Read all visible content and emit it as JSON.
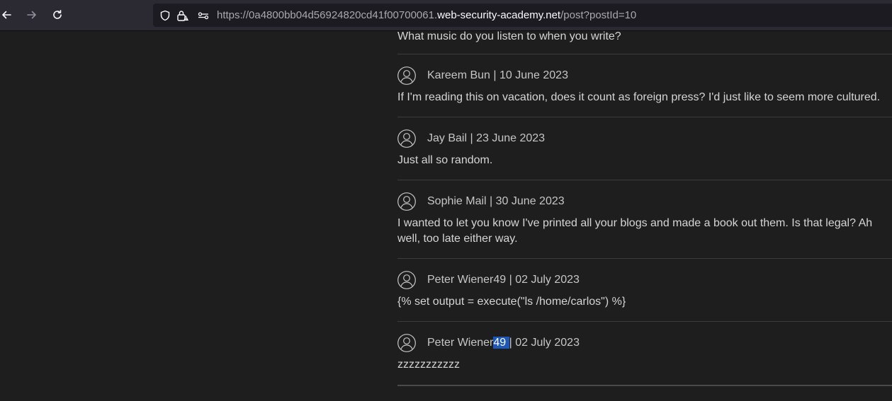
{
  "browser": {
    "back_icon": "arrow-left-icon",
    "forward_icon": "arrow-right-icon",
    "reload_icon": "reload-icon",
    "url_prefix": "https://0a4800bb04d56924820cd41f00700061.",
    "url_host": "web-security-academy.net",
    "url_path": "/post?postId=10"
  },
  "comments_partial": {
    "text": "What music do you listen to when you write?"
  },
  "comments": [
    {
      "author": "Kareem Bun",
      "sep": " | ",
      "date": "10 June 2023",
      "text": "If I'm reading this on vacation, does it count as foreign press? I'd just like to seem more cultured."
    },
    {
      "author": "Jay Bail",
      "sep": " | ",
      "date": "23 June 2023",
      "text": "Just all so random."
    },
    {
      "author": "Sophie Mail",
      "sep": " | ",
      "date": "30 June 2023",
      "text": "I wanted to let you know I've printed all your blogs and made a book out them. Is that legal? Ah well, too late either way."
    },
    {
      "author": "Peter Wiener49",
      "sep": " | ",
      "date": "02 July 2023",
      "text": "{% set output = execute(\"ls /home/carlos\") %}"
    },
    {
      "author_plain": "Peter Wiener",
      "author_selected": "49 ",
      "sep": "| ",
      "date": "02 July 2023",
      "text": "zzzzzzzzzzz"
    }
  ]
}
